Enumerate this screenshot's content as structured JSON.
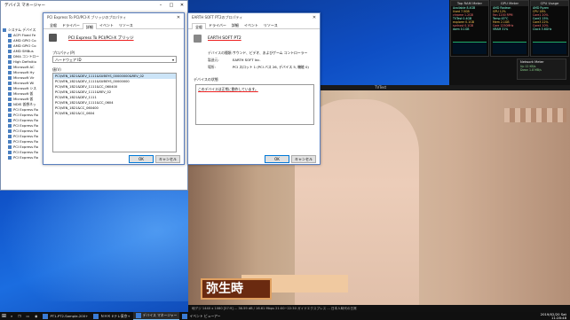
{
  "device_manager": {
    "title": "デバイス マネージャー",
    "tree": [
      "システム デバイス",
      "ACPI Fixed Fe",
      "AMD GPIO Co",
      "AMD GPIO Co",
      "AMD SMBus",
      "DMA コントロー",
      "High Definitio",
      "Microsoft AC",
      "Microsoft Hy",
      "Microsoft Vir",
      "Microsoft Wi",
      "Microsoft シス",
      "Microsoft 仮",
      "Microsoft 仮",
      "NDIS 仮想ネッ",
      "PCI Express Ro",
      "PCI Express Ro",
      "PCI Express Ro",
      "PCI Express Ro",
      "PCI Express Ro",
      "PCI Express Ro",
      "PCI Express Ro",
      "PCI Express Ro",
      "PCI Express Ro",
      "PCI Express Ro"
    ]
  },
  "dialog1": {
    "title": "PCI Express To PCI/PCI-X ブリッジのプロパティ",
    "tabs": [
      "全般",
      "ドライバー",
      "詳細",
      "イベント",
      "リソース"
    ],
    "device_name": "PCI Express To PCI/PCI-X ブリッジ",
    "property_label": "プロパティ(P)",
    "property_value": "ハードウェア ID",
    "value_label": "値(V)",
    "values": [
      "PCI\\VEN_1B21&DEV_1111&SUBSYS_00000000&REV_02",
      "PCI\\VEN_1B21&DEV_1111&SUBSYS_00000000",
      "PCI\\VEN_1B21&DEV_1111&CC_060400",
      "PCI\\VEN_1B21&DEV_1111&REV_02",
      "PCI\\VEN_1B21&DEV_1111",
      "PCI\\VEN_1B21&DEV_1111&CC_0604",
      "PCI\\VEN_1B21&CC_060400",
      "PCI\\VEN_1B21&CC_0604"
    ],
    "ok": "OK",
    "cancel": "キャンセル"
  },
  "dialog2": {
    "title": "EARTH SOFT PT2のプロパティ",
    "tabs": [
      "全般",
      "ドライバー",
      "詳細",
      "イベント",
      "リソース"
    ],
    "device_name": "EARTH SOFT PT2",
    "rows": [
      {
        "k": "デバイスの種類:",
        "v": "サウンド、ビデオ、およびゲーム コントローラー"
      },
      {
        "k": "製造元:",
        "v": "EARTH SOFT Inc."
      },
      {
        "k": "場所:",
        "v": "PCI スロット 1 (PCI バス 26, デバイス 5, 機能 0)"
      }
    ],
    "status_group": "デバイスの状態",
    "status_text": "このデバイスは正常に動作しています。",
    "ok": "OK",
    "cancel": "キャンセル"
  },
  "video": {
    "title_bar": "TVTest",
    "caption": "弥生時",
    "status": "地デジ    1440 x 1080 [57:9]   ...   36.59 dB / 16.61 Mbps   21:00~22:30 ガイドエクスプレス   ...   日本人時代の日常"
  },
  "monitors": {
    "panels": [
      {
        "title": "Top RAM Meter",
        "rows": [
          "Available 8.4GB",
          "Used 7.5GB",
          "chrome 1.2GB",
          "TVTest 0.4GB",
          "explorer 0.1GB",
          "svchost 0.1GB",
          "dwm 0.1GB"
        ]
      },
      {
        "title": "GPU Meter",
        "rows": [
          "AMD Radeon",
          "GPU 12%",
          "Fan 1200 RPM",
          "Temp 45°C",
          "Mem 2.1GB",
          "Core 1250MHz",
          "VRAM 31%"
        ]
      },
      {
        "title": "CPU Usage",
        "rows": [
          "AMD Ryzen",
          "CPU 18%",
          "Core1 20%",
          "Core2 15%",
          "Core3 22%",
          "Core4 10%",
          "Clock 3.6GHz"
        ]
      }
    ],
    "nic": {
      "title": "Network Meter",
      "rows": [
        "Up 12 KB/s",
        "Down 1.8 MB/s"
      ]
    }
  },
  "taskbar": {
    "tasks": [
      {
        "label": "PT1-PT2-Sample-200+",
        "active": false
      },
      {
        "label": "ＮＨＫ Eテレ東京+",
        "active": false
      },
      {
        "label": "デバイス マネージャー",
        "active": true
      },
      {
        "label": "イベント ビューアー",
        "active": false
      }
    ],
    "time": "11:28:48",
    "date": "2019/02/20 Sat"
  }
}
